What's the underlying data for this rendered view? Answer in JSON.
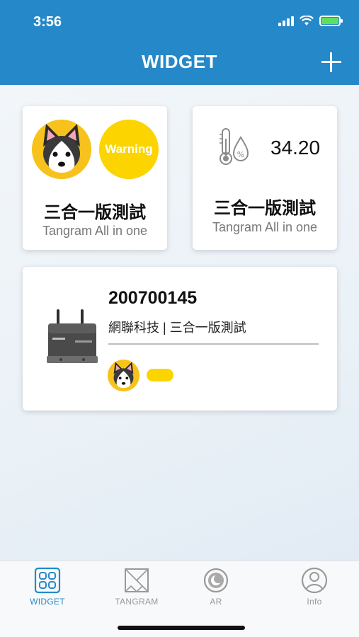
{
  "status_bar": {
    "time": "3:56"
  },
  "header": {
    "title": "WIDGET"
  },
  "widgets": [
    {
      "title": "三合一版測試",
      "subtitle": "Tangram All in one",
      "badge": "Warning"
    },
    {
      "title": "三合一版測試",
      "subtitle": "Tangram All in one",
      "reading": "34.20"
    }
  ],
  "device": {
    "id": "200700145",
    "description": "網聯科技 | 三合一版測試"
  },
  "tabs": [
    {
      "label": "WIDGET",
      "icon": "widget-grid-icon",
      "active": true
    },
    {
      "label": "TANGRAM",
      "icon": "tangram-icon",
      "active": false
    },
    {
      "label": "AR",
      "icon": "ar-icon",
      "active": false
    },
    {
      "label": "Info",
      "icon": "user-icon",
      "active": false
    }
  ],
  "colors": {
    "header": "#2589c9",
    "warning": "#fcd400",
    "avatar": "#f6c21b",
    "battery": "#5be060",
    "tab_active": "#2589c9",
    "tab_inactive": "#999999"
  }
}
